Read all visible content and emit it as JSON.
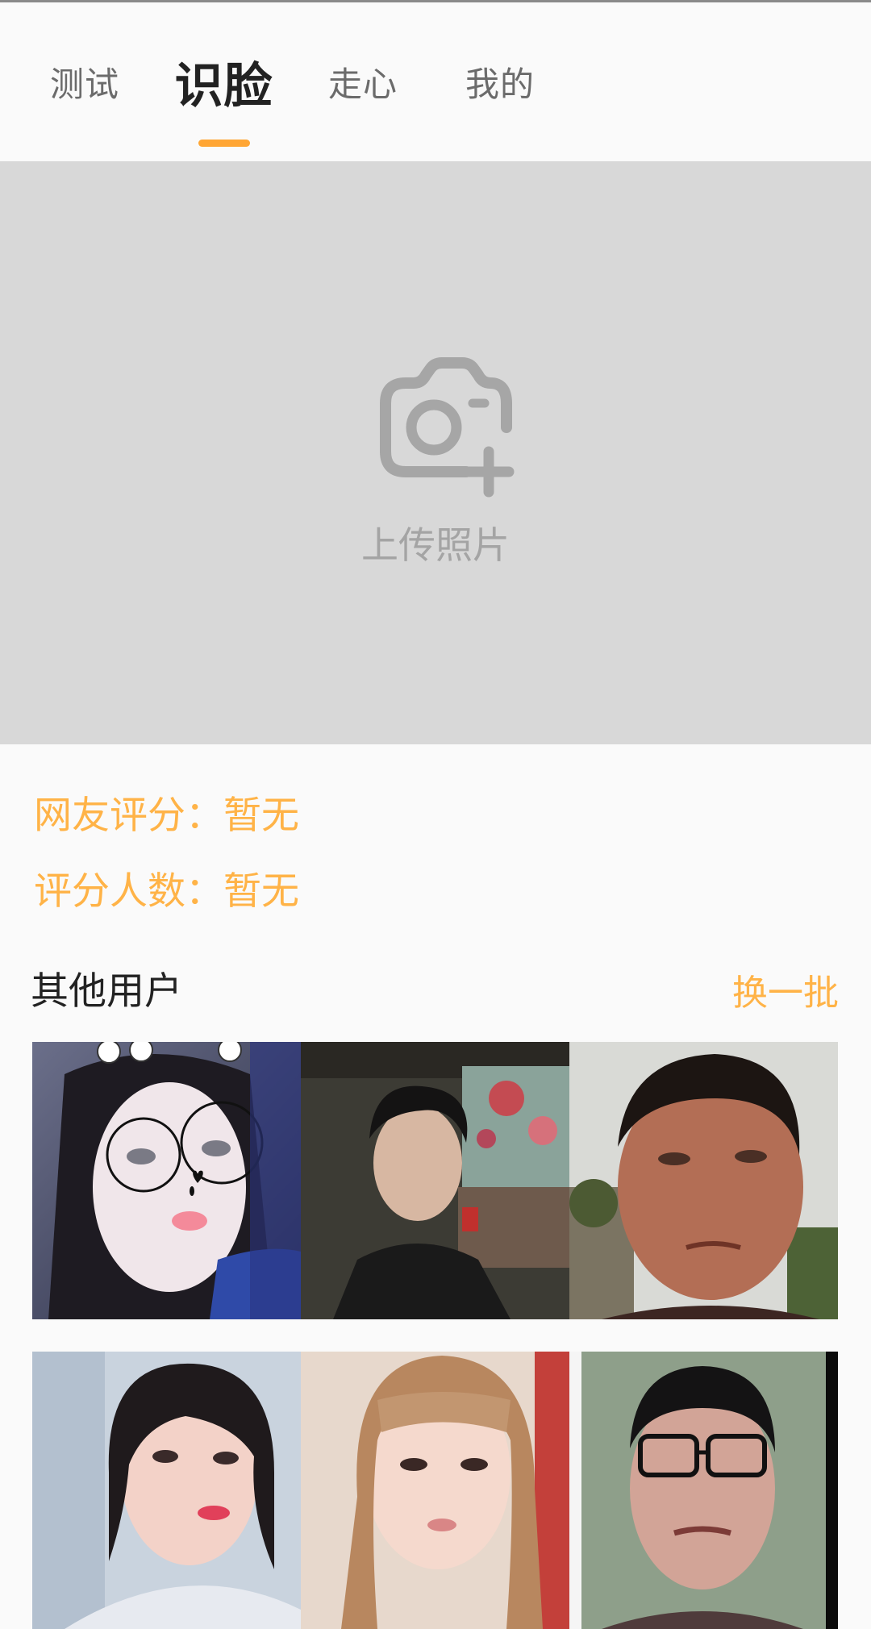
{
  "tabs": [
    {
      "label": "测试"
    },
    {
      "label": "识脸"
    },
    {
      "label": "走心"
    },
    {
      "label": "我的"
    }
  ],
  "upload": {
    "label": "上传照片",
    "icon": "camera-plus-icon"
  },
  "stats": {
    "rating": "网友评分：暂无",
    "count": "评分人数：暂无"
  },
  "others": {
    "title": "其他用户",
    "refresh": "换一批"
  },
  "colors": {
    "accent": "#ffa634",
    "stat_text": "#ffb347",
    "upload_bg": "#d8d8d8"
  },
  "user_photos": [
    {
      "name": "user-photo-1"
    },
    {
      "name": "user-photo-2"
    },
    {
      "name": "user-photo-3"
    },
    {
      "name": "user-photo-4"
    },
    {
      "name": "user-photo-5"
    },
    {
      "name": "user-photo-6"
    }
  ]
}
